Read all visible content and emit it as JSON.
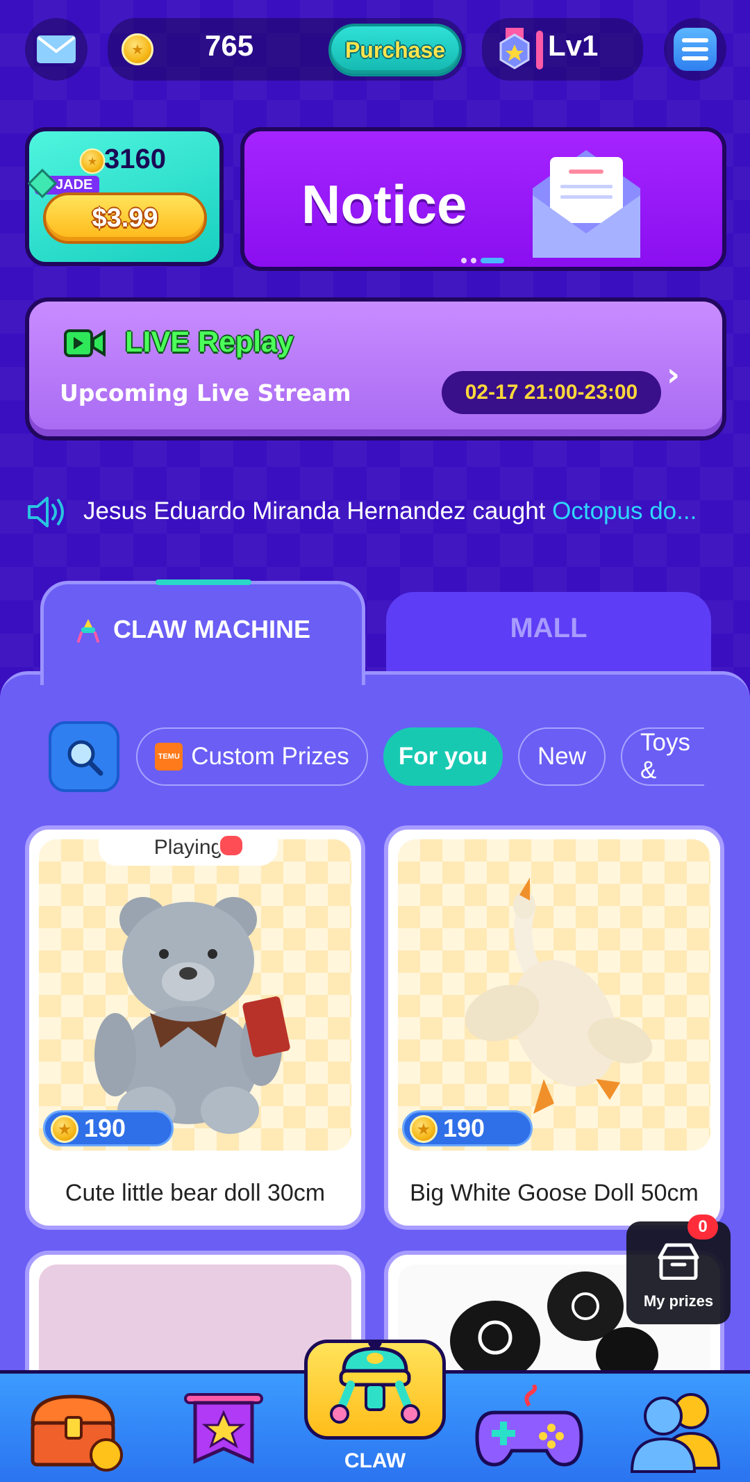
{
  "top_bar": {
    "coin_balance": "765",
    "purchase_label": "Purchase",
    "level": "Lv1"
  },
  "offer": {
    "coins": "3160",
    "tag": "JADE",
    "price": "$3.99"
  },
  "notice": {
    "title": "Notice"
  },
  "live": {
    "title": "LIVE Replay",
    "subtitle": "Upcoming Live Stream",
    "time": "02-17 21:00-23:00"
  },
  "ticker": {
    "text": "Jesus Eduardo Miranda Hernandez caught ",
    "prize": "Octopus do..."
  },
  "tabs": [
    {
      "label": "CLAW MACHINE",
      "active": true
    },
    {
      "label": "MALL",
      "active": false
    }
  ],
  "filters": [
    {
      "label": "Custom Prizes",
      "badge": "TEMU"
    },
    {
      "label": "For you",
      "active": true
    },
    {
      "label": "New"
    },
    {
      "label": "Toys &"
    }
  ],
  "products": [
    {
      "title": "Cute little bear doll 30cm",
      "price": "190",
      "status": "Playing"
    },
    {
      "title": "Big White Goose Doll 50cm",
      "price": "190"
    }
  ],
  "my_prizes": {
    "label": "My prizes",
    "count": "0"
  },
  "bottom_nav": {
    "center_label": "CLAW"
  },
  "colors": {
    "background": "#3a0fc0",
    "panel": "#6a5ef5",
    "accent_teal": "#18c9b2",
    "notice_purple": "#9a18f8",
    "live_time_text": "#ffd83a",
    "ticker_prize": "#2fd8ff"
  }
}
